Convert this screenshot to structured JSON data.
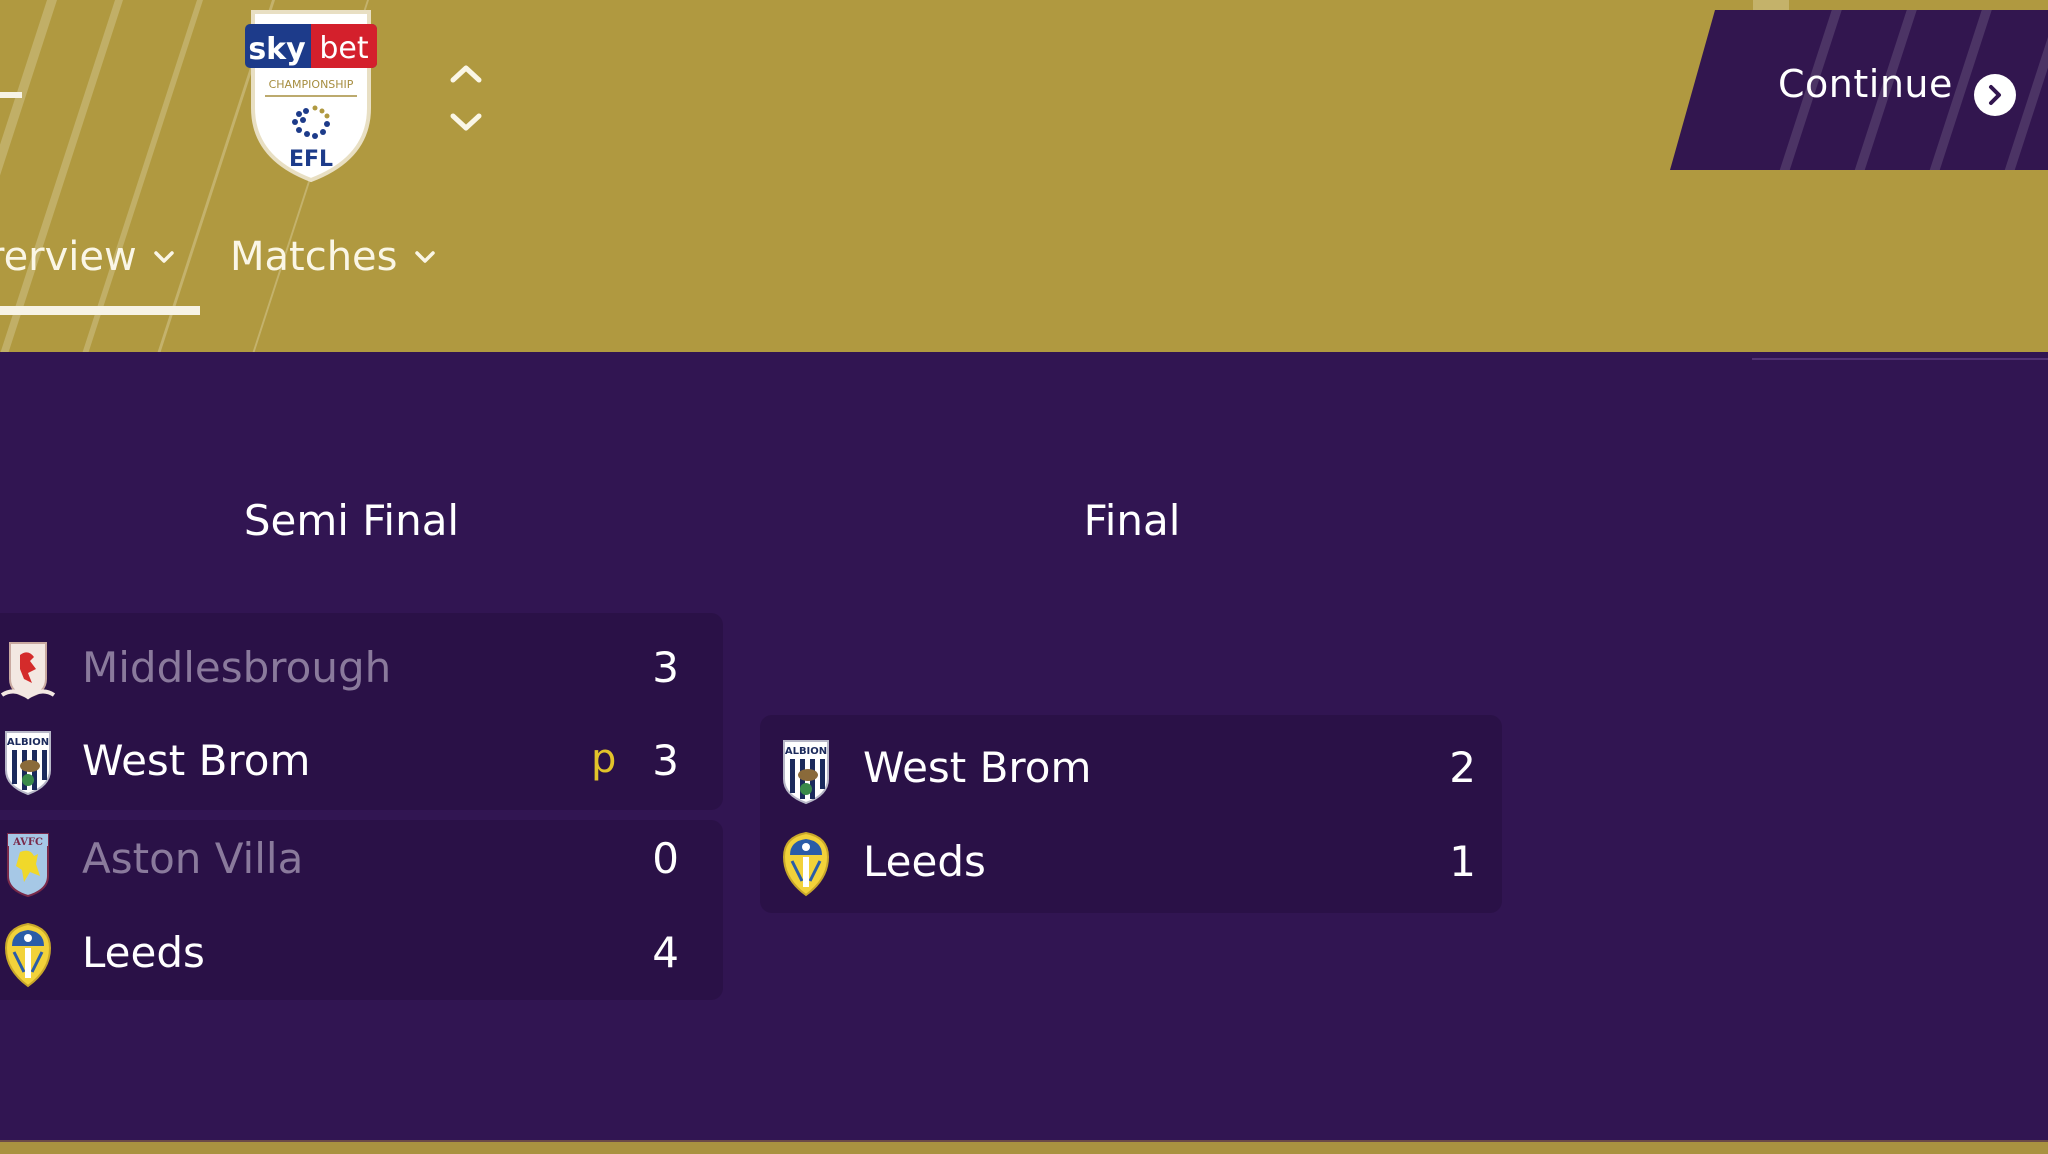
{
  "header": {
    "competition_logo": {
      "sponsor_left": "sky",
      "sponsor_right": "bet",
      "league": "CHAMPIONSHIP",
      "org": "EFL"
    },
    "tabs": [
      {
        "label": "rerview",
        "active": true
      },
      {
        "label": "Matches",
        "active": false
      }
    ],
    "continue_label": "Continue",
    "icons": {
      "prev": "chevron-up-icon",
      "next": "chevron-down-icon",
      "continue": "chevron-right-circle-icon",
      "tab_dropdown": "chevron-down-icon"
    }
  },
  "bracket": {
    "rounds": [
      {
        "title": "Semi Final",
        "matches": [
          {
            "teams": [
              {
                "name": "Middlesbrough",
                "score": "3",
                "penalties": "",
                "winner": false,
                "crest": "middlesbrough-crest"
              },
              {
                "name": "West Brom",
                "score": "3",
                "penalties": "p",
                "winner": true,
                "crest": "west-brom-crest"
              }
            ]
          },
          {
            "teams": [
              {
                "name": "Aston Villa",
                "score": "0",
                "penalties": "",
                "winner": false,
                "crest": "aston-villa-crest"
              },
              {
                "name": "Leeds",
                "score": "4",
                "penalties": "",
                "winner": true,
                "crest": "leeds-crest"
              }
            ]
          }
        ]
      },
      {
        "title": "Final",
        "matches": [
          {
            "teams": [
              {
                "name": "West Brom",
                "score": "2",
                "penalties": "",
                "winner": true,
                "crest": "west-brom-crest"
              },
              {
                "name": "Leeds",
                "score": "1",
                "penalties": "",
                "winner": true,
                "crest": "leeds-crest"
              }
            ]
          }
        ]
      }
    ]
  },
  "colors": {
    "header_gold": "#b09940",
    "background_purple": "#311552",
    "card_purple": "#2a1147",
    "penalty_yellow": "#e2c32a",
    "loser_text": "#8a7a9c"
  }
}
